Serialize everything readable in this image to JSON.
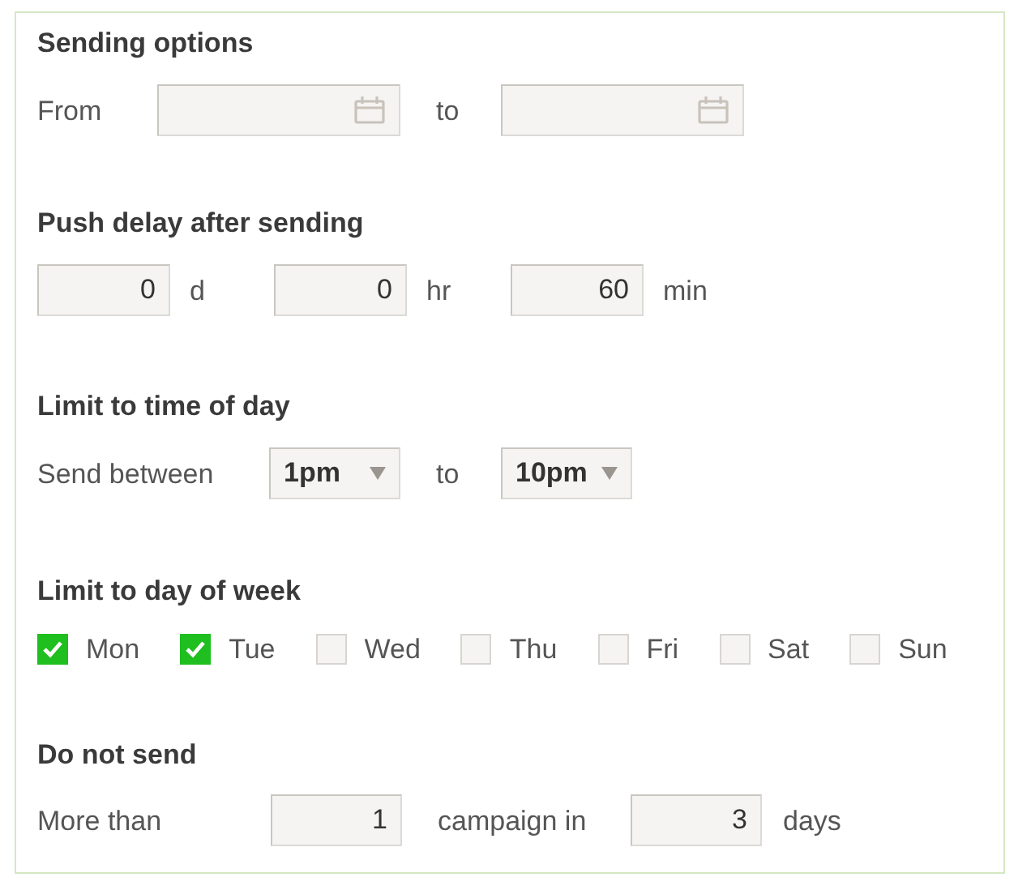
{
  "sending_options": {
    "title": "Sending options",
    "from_label": "From",
    "to_label": "to"
  },
  "push_delay": {
    "title": "Push delay after sending",
    "fields": [
      {
        "value": "0",
        "unit": "d"
      },
      {
        "value": "0",
        "unit": "hr"
      },
      {
        "value": "60",
        "unit": "min"
      }
    ]
  },
  "time_of_day": {
    "title": "Limit to time of day",
    "label": "Send between",
    "to_label": "to",
    "from": "1pm",
    "to": "10pm"
  },
  "day_of_week": {
    "title": "Limit to day of week",
    "days": [
      {
        "label": "Mon",
        "checked": true
      },
      {
        "label": "Tue",
        "checked": true
      },
      {
        "label": "Wed",
        "checked": false
      },
      {
        "label": "Thu",
        "checked": false
      },
      {
        "label": "Fri",
        "checked": false
      },
      {
        "label": "Sat",
        "checked": false
      },
      {
        "label": "Sun",
        "checked": false
      }
    ]
  },
  "do_not_send": {
    "title": "Do not send",
    "label": "More than",
    "count": "1",
    "middle_label": "campaign in",
    "days": "3",
    "days_label": "days"
  }
}
